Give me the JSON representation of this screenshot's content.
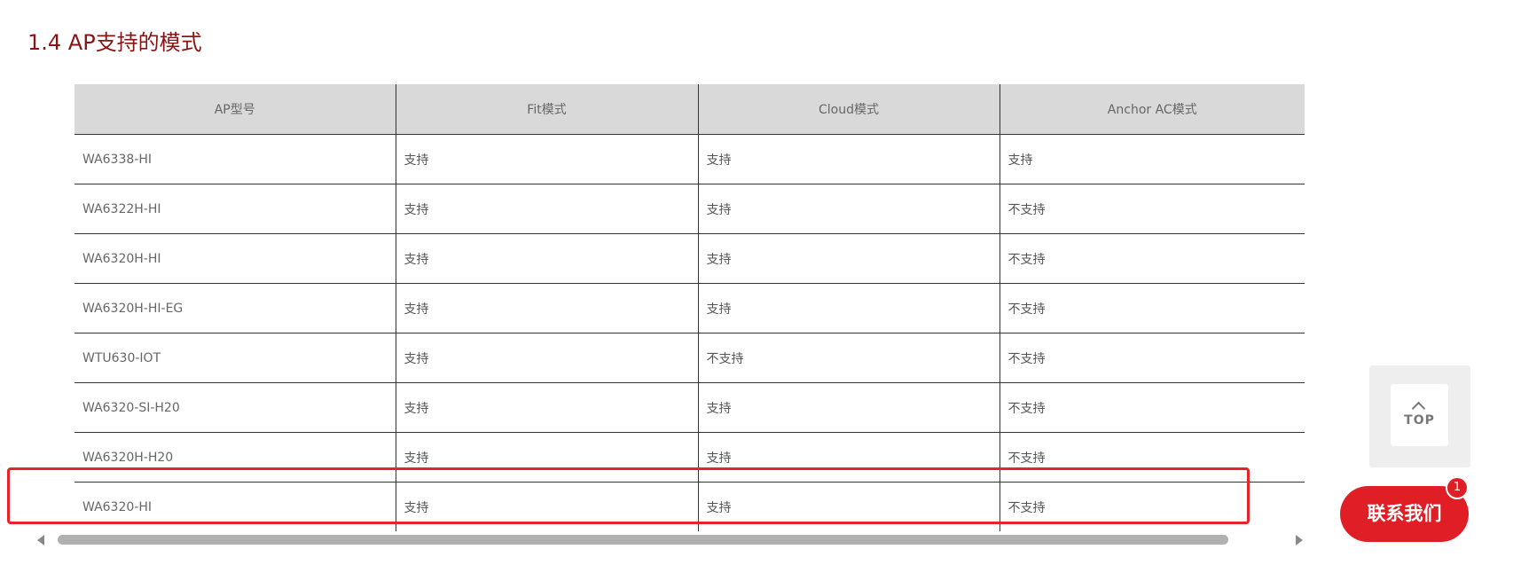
{
  "section": {
    "title": "1.4  AP支持的模式"
  },
  "table": {
    "headers": [
      "AP型号",
      "Fit模式",
      "Cloud模式",
      "Anchor AC模式"
    ],
    "rows": [
      [
        "WA6338-HI",
        "支持",
        "支持",
        "支持"
      ],
      [
        "WA6322H-HI",
        "支持",
        "支持",
        "不支持"
      ],
      [
        "WA6320H-HI",
        "支持",
        "支持",
        "不支持"
      ],
      [
        "WA6320H-HI-EG",
        "支持",
        "支持",
        "不支持"
      ],
      [
        "WTU630-IOT",
        "支持",
        "不支持",
        "不支持"
      ],
      [
        "WA6320-SI-H20",
        "支持",
        "支持",
        "不支持"
      ],
      [
        "WA6320H-H20",
        "支持",
        "支持",
        "不支持"
      ],
      [
        "WA6320-HI",
        "支持",
        "支持",
        "不支持"
      ]
    ],
    "highlighted_row": 7
  },
  "widgets": {
    "top_label": "TOP",
    "contact_label": "联系我们",
    "badge_count": "1"
  },
  "colors": {
    "title": "#8a1414",
    "header_bg": "#d9d9d9",
    "highlight": "#e8232a",
    "contact_bg": "#e01e25"
  },
  "icons": {
    "top": "chevron-up-icon",
    "scroll_left": "arrow-left-icon",
    "scroll_right": "arrow-right-icon"
  }
}
